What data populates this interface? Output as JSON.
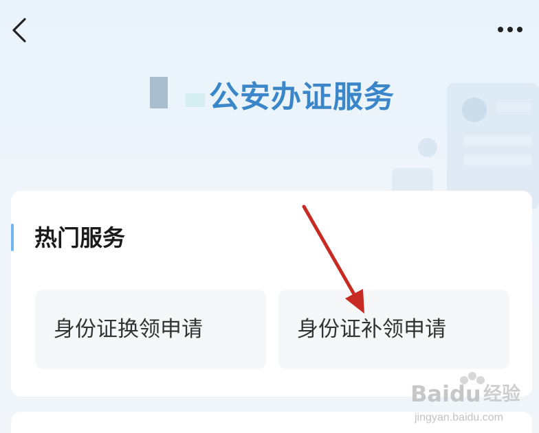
{
  "header": {
    "title": "公安办证服务"
  },
  "section": {
    "title": "热门服务"
  },
  "services": [
    {
      "label": "身份证换领申请"
    },
    {
      "label": "身份证补领申请"
    }
  ],
  "watermark": {
    "brand": "Baidu",
    "suffix": "经验",
    "url": "jingyan.baidu.com"
  },
  "colors": {
    "accent": "#3a86c8",
    "section_bar": "#70b7f0",
    "annotation_arrow": "#c62a22"
  },
  "icons": {
    "back": "chevron-left-icon",
    "more": "more-horizontal-icon"
  }
}
